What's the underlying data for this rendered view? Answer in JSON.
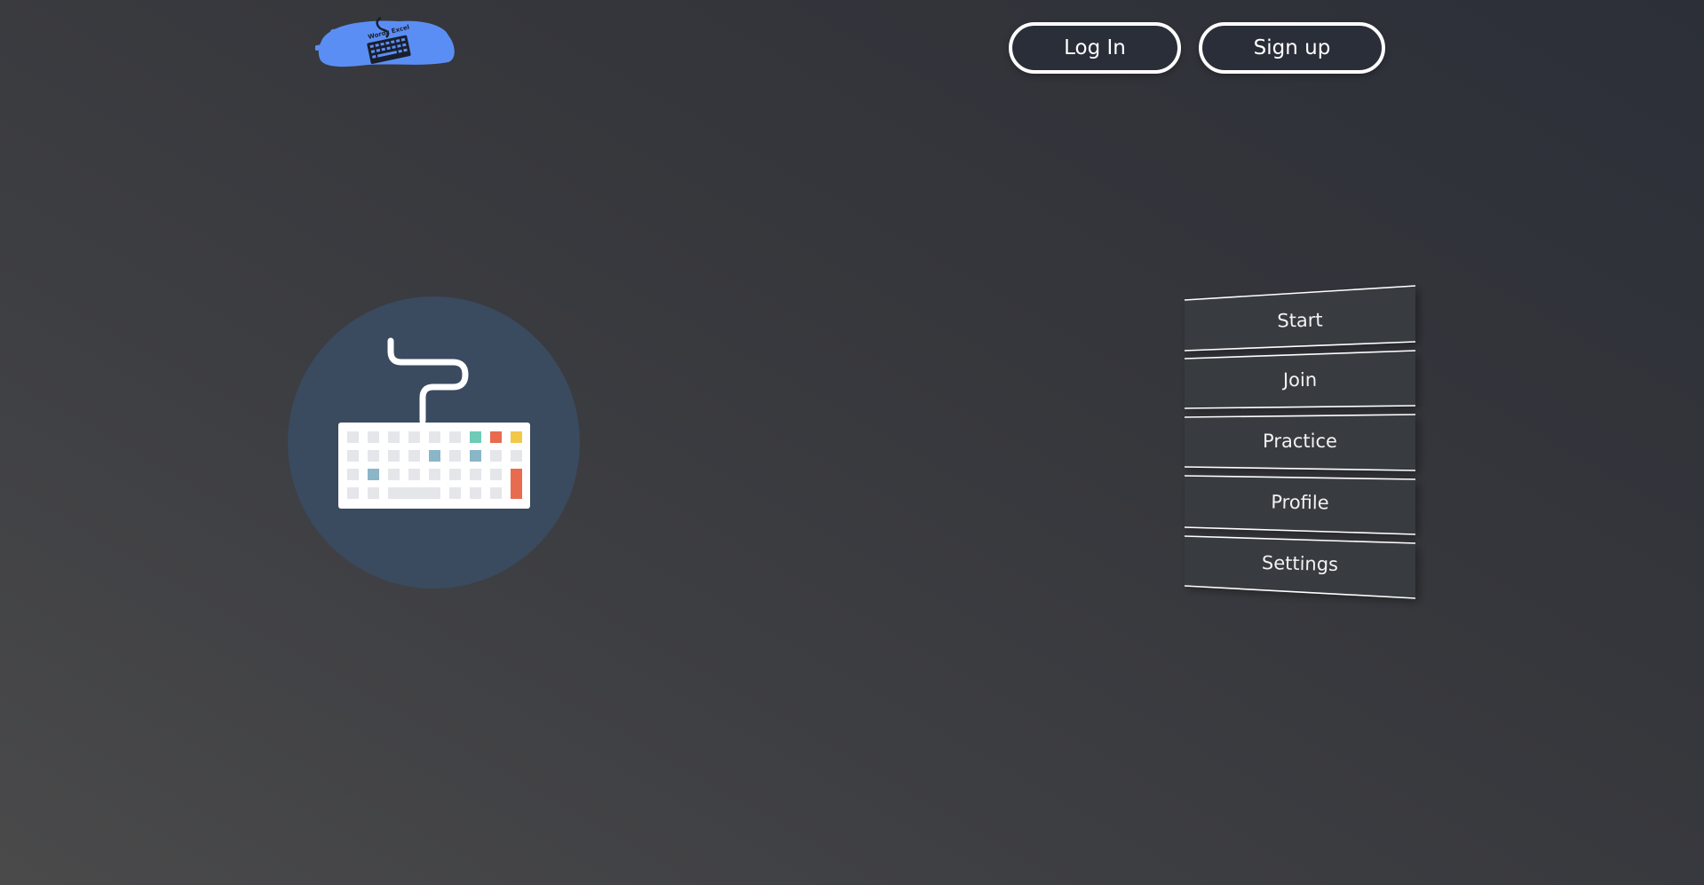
{
  "header": {
    "logo_text": "Wordz Excel",
    "login_label": "Log In",
    "signup_label": "Sign up"
  },
  "hero": {
    "icon": "keyboard-icon",
    "circle_color": "#3a4a5f"
  },
  "menu": {
    "items": [
      {
        "label": "Start"
      },
      {
        "label": "Join"
      },
      {
        "label": "Practice"
      },
      {
        "label": "Profile"
      },
      {
        "label": "Settings"
      }
    ]
  },
  "colors": {
    "logo_brush": "#5b8ef5",
    "button_bg": "#2a2e38",
    "key_teal": "#6dcbb6",
    "key_red": "#e86b4f",
    "key_yellow": "#f2c84b",
    "key_blue": "#8ab6c8",
    "key_gray": "#e4e6ea"
  }
}
